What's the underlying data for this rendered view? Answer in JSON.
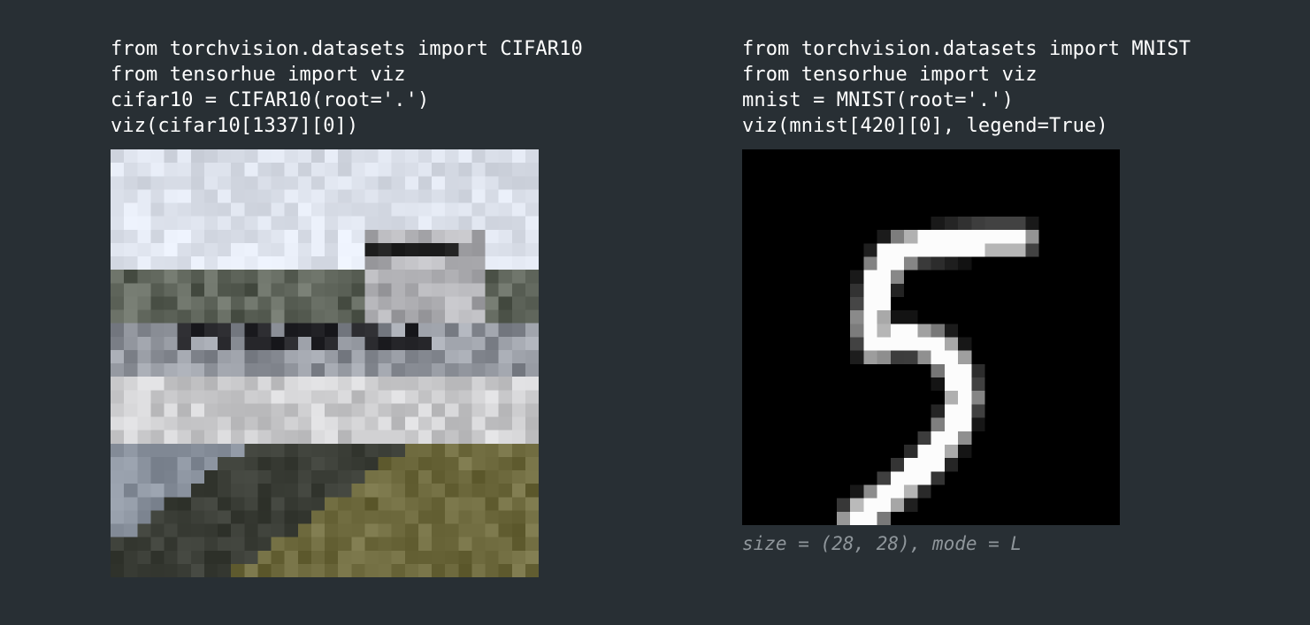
{
  "left": {
    "code_lines": [
      "from torchvision.datasets import CIFAR10",
      "from tensorhue import viz",
      "cifar10 = CIFAR10(root='.')",
      "viz(cifar10[1337][0])"
    ],
    "image": {
      "kind": "rgb",
      "width": 32,
      "height": 32
    }
  },
  "right": {
    "code_lines": [
      "from torchvision.datasets import MNIST",
      "from tensorhue import viz",
      "mnist = MNIST(root='.')",
      "viz(mnist[420][0], legend=True)"
    ],
    "image": {
      "kind": "grayscale",
      "width": 28,
      "height": 28
    },
    "legend": "size = (28, 28), mode = L"
  },
  "colors": {
    "background": "#282f34",
    "code_text": "#ffffff",
    "legend_text": "#8f969b"
  }
}
